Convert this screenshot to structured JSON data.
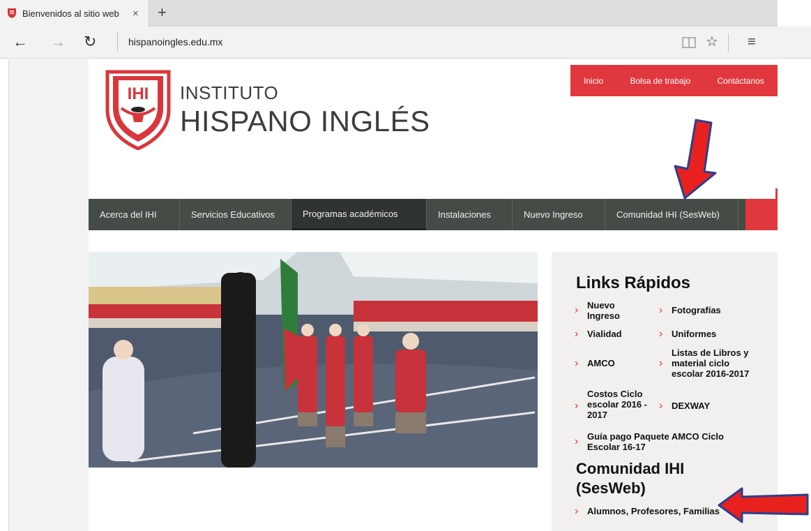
{
  "browser": {
    "tab_title": "Bienvenidos al sitio web",
    "tab_close": "×",
    "new_tab": "+",
    "url": "hispanoingles.edu.mx",
    "back": "←",
    "forward": "→",
    "refresh": "↻",
    "reading_icon": "reading-view-icon",
    "favorite": "☆",
    "hub": "≡"
  },
  "site": {
    "top_links": [
      "Inicio",
      "Bolsa de trabajo",
      "Contáctanos"
    ],
    "brand_line1": "INSTITUTO",
    "brand_line2": "HISPANO INGLÉS",
    "logo_letters": "IHI",
    "nav": [
      "Acerca del IHI",
      "Servicios Educativos",
      "Programas académicos",
      "Instalaciones",
      "Nuevo Ingreso",
      "Comunidad IHI (SesWeb)"
    ],
    "sidebar": {
      "title": "Links Rápidos",
      "links": [
        "Nuevo Ingreso",
        "Fotografías",
        "Vialidad",
        "Uniformes",
        "AMCO",
        "Listas de Libros y material ciclo escolar 2016-2017",
        "Costos Ciclo escolar 2016 - 2017",
        "DEXWAY",
        "Guía pago Paquete AMCO Ciclo Escolar 16-17"
      ],
      "community_title": "Comunidad IHI (SesWeb)",
      "community_link": "Alumnos, Profesores, Familias"
    },
    "colors": {
      "accent": "#e0383e",
      "nav_bg": "#454c46",
      "sidebar_bg": "#f1f0ee",
      "annotation_arrow": "#e8211f",
      "annotation_outline": "#2b3f8f"
    }
  }
}
